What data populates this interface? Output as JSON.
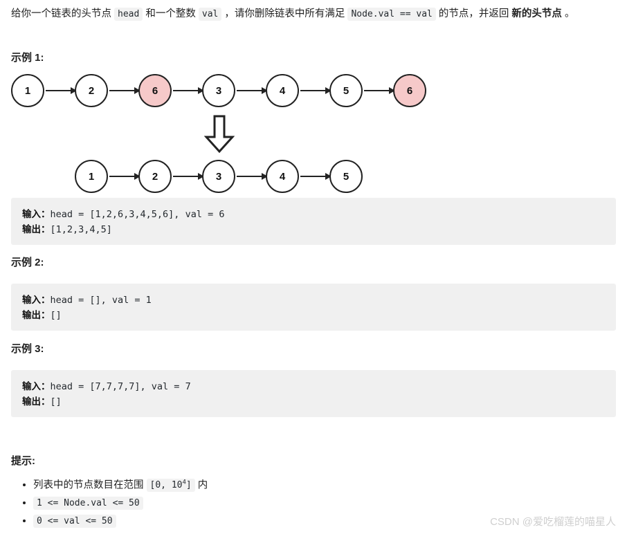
{
  "intro": {
    "seg1": "给你一个链表的头节点 ",
    "code1": "head",
    "seg2": " 和一个整数 ",
    "code2": "val",
    "seg3": " ，请你删除链表中所有满足 ",
    "code3": "Node.val == val",
    "seg4": " 的节点，并返回 ",
    "bold1": "新的头节点",
    "seg5": " 。"
  },
  "headings": {
    "example1": "示例 1:",
    "example2": "示例 2:",
    "example3": "示例 3:",
    "tips": "提示:"
  },
  "figure": {
    "row1": [
      {
        "value": "1",
        "highlight": false
      },
      {
        "value": "2",
        "highlight": false
      },
      {
        "value": "6",
        "highlight": true
      },
      {
        "value": "3",
        "highlight": false
      },
      {
        "value": "4",
        "highlight": false
      },
      {
        "value": "5",
        "highlight": false
      },
      {
        "value": "6",
        "highlight": true
      }
    ],
    "row2": [
      {
        "value": "1",
        "highlight": false
      },
      {
        "value": "2",
        "highlight": false
      },
      {
        "value": "3",
        "highlight": false
      },
      {
        "value": "4",
        "highlight": false
      },
      {
        "value": "5",
        "highlight": false
      }
    ],
    "transform_arrow": "down-arrow",
    "colors": {
      "node_fill": "#ffffff",
      "node_highlight_fill": "#f6c9c9",
      "node_stroke": "#222222"
    }
  },
  "examples": [
    {
      "input_label": "输入：",
      "input_value": "head = [1,2,6,3,4,5,6], val = 6",
      "output_label": "输出：",
      "output_value": "[1,2,3,4,5]"
    },
    {
      "input_label": "输入：",
      "input_value": "head = [], val = 1",
      "output_label": "输出：",
      "output_value": "[]"
    },
    {
      "input_label": "输入：",
      "input_value": "head = [7,7,7,7], val = 7",
      "output_label": "输出：",
      "output_value": "[]"
    }
  ],
  "hints": {
    "item1": {
      "prefix": "列表中的节点数目在范围 ",
      "code_a": "[0, 10",
      "code_sup": "4",
      "code_b": "]",
      "suffix": " 内"
    },
    "item2": "1 <= Node.val <= 50",
    "item3": "0 <= val <= 50"
  },
  "watermark": "CSDN @爱吃榴莲的喵星人"
}
